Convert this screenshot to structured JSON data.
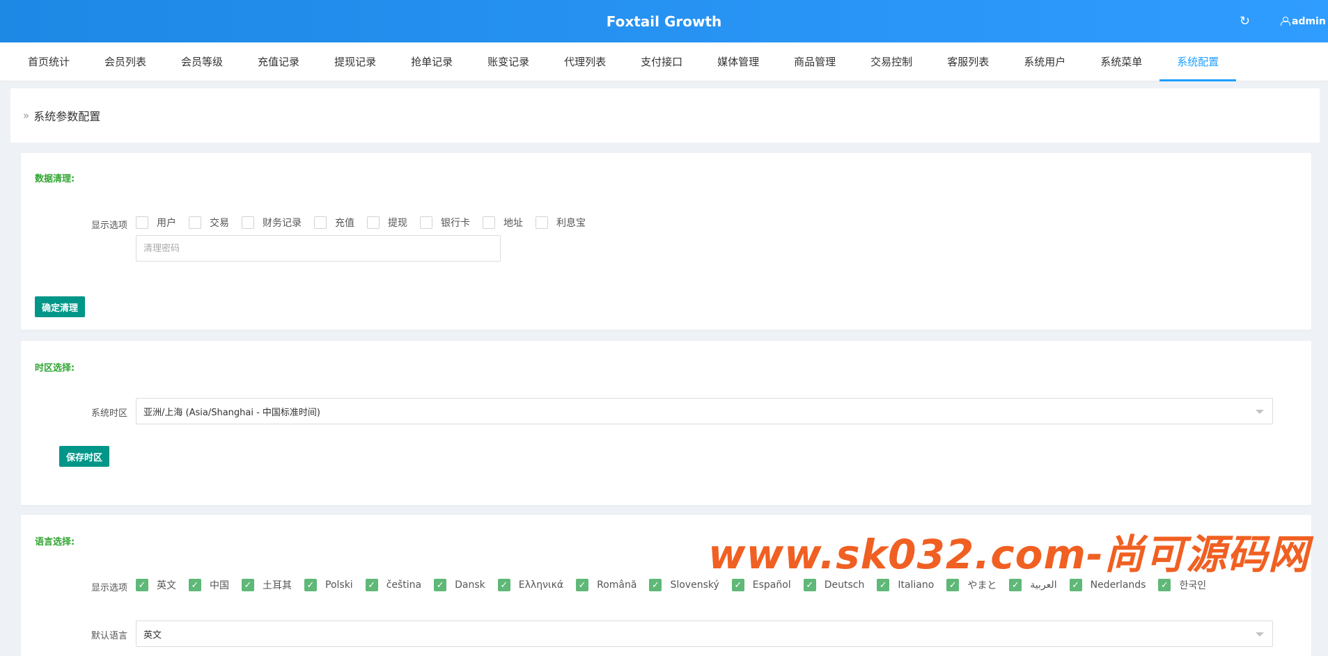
{
  "header": {
    "title": "Foxtail Growth",
    "refresh_icon": "↻",
    "user_label": "admin"
  },
  "nav": {
    "items": [
      "首页统计",
      "会员列表",
      "会员等级",
      "充值记录",
      "提现记录",
      "抢单记录",
      "账变记录",
      "代理列表",
      "支付接口",
      "媒体管理",
      "商品管理",
      "交易控制",
      "客服列表",
      "系统用户",
      "系统菜单",
      "系统配置"
    ],
    "active": "系统配置"
  },
  "breadcrumb": {
    "arrows": "»",
    "title": "系统参数配置"
  },
  "data_clean": {
    "title": "数据清理:",
    "options_label": "显示选项",
    "options": [
      "用户",
      "交易",
      "财务记录",
      "充值",
      "提现",
      "银行卡",
      "地址",
      "利息宝"
    ],
    "password_placeholder": "清理密码",
    "confirm_label": "确定清理"
  },
  "timezone": {
    "title": "时区选择:",
    "label": "系统时区",
    "value": "亚洲/上海 (Asia/Shanghai - 中国标准时间)",
    "save_label": "保存时区"
  },
  "language": {
    "title": "语言选择:",
    "options_label": "显示选项",
    "options": [
      "英文",
      "中国",
      "土耳其",
      "Polski",
      "čeština",
      "Dansk",
      "Ελληνικά",
      "Română",
      "Slovenský",
      "Español",
      "Deutsch",
      "Italiano",
      "やまと",
      "العربية",
      "Nederlands",
      "한국인"
    ],
    "default_label": "默认语言",
    "default_value": "英文"
  },
  "watermark": "www.sk032.com-尚可源码网",
  "colors": {
    "header": "#2196f3",
    "active_tab": "#1e9fff",
    "section_title": "#2fa52f",
    "button": "#009688",
    "checked": "#5fb878",
    "watermark": "#f06022"
  }
}
